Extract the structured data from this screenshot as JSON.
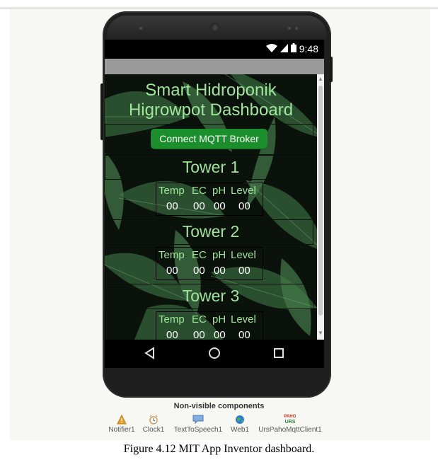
{
  "status_bar": {
    "time": "9:48"
  },
  "app": {
    "title_line1": "Smart Hidroponik",
    "title_line2": "Higrowpot Dashboard",
    "connect_button": "Connect MQTT Broker"
  },
  "towers": [
    {
      "name": "Tower 1",
      "headers": [
        "Temp",
        "EC",
        "pH",
        "Level"
      ],
      "values": [
        "00",
        "00",
        "00",
        "00"
      ]
    },
    {
      "name": "Tower 2",
      "headers": [
        "Temp",
        "EC",
        "pH",
        "Level"
      ],
      "values": [
        "00",
        "00",
        "00",
        "00"
      ]
    },
    {
      "name": "Tower 3",
      "headers": [
        "Temp",
        "EC",
        "pH",
        "Level"
      ],
      "values": [
        "00",
        "00",
        "00",
        "00"
      ]
    }
  ],
  "non_visible": {
    "title": "Non-visible components",
    "components": [
      {
        "label": "Notifier1",
        "icon": "warning-icon"
      },
      {
        "label": "Clock1",
        "icon": "alarm-clock-icon"
      },
      {
        "label": "TextToSpeech1",
        "icon": "speech-bubble-icon"
      },
      {
        "label": "Web1",
        "icon": "globe-icon"
      },
      {
        "label": "UrsPahoMqttClient1",
        "icon": "urs-mqtt-icon",
        "icon_text_top": "PAHO",
        "icon_text_bottom": "URS"
      }
    ]
  },
  "caption": "Figure 4.12 MIT App Inventor dashboard.",
  "colors": {
    "title_green": "#9fe69a",
    "button_green": "#1a8f2b",
    "jungle_dark": "#0b120c"
  }
}
